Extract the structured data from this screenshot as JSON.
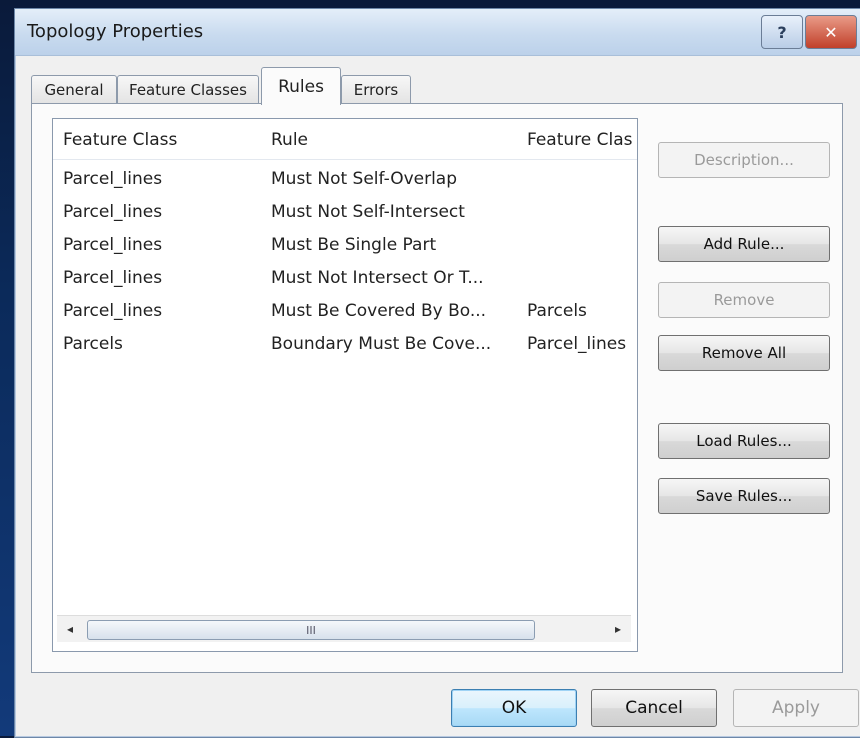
{
  "window": {
    "title": "Topology Properties"
  },
  "tabs": [
    {
      "label": "General"
    },
    {
      "label": "Feature Classes"
    },
    {
      "label": "Rules"
    },
    {
      "label": "Errors"
    }
  ],
  "rules_list": {
    "columns": [
      "Feature Class",
      "Rule",
      "Feature Clas"
    ],
    "rows": [
      [
        "Parcel_lines",
        "Must Not Self-Overlap",
        ""
      ],
      [
        "Parcel_lines",
        "Must Not Self-Intersect",
        ""
      ],
      [
        "Parcel_lines",
        "Must Be Single Part",
        ""
      ],
      [
        "Parcel_lines",
        "Must Not Intersect Or T...",
        ""
      ],
      [
        "Parcel_lines",
        "Must Be Covered By Bo...",
        "Parcels"
      ],
      [
        "Parcels",
        "Boundary Must Be Cove...",
        "Parcel_lines"
      ]
    ],
    "scrollbar_thumb_label": "III"
  },
  "side_buttons": {
    "description": "Description...",
    "add_rule": "Add Rule...",
    "remove": "Remove",
    "remove_all": "Remove All",
    "load_rules": "Load Rules...",
    "save_rules": "Save Rules..."
  },
  "footer": {
    "ok": "OK",
    "cancel": "Cancel",
    "apply": "Apply"
  },
  "titlebar_buttons": {
    "help": "?",
    "close": "✕"
  }
}
